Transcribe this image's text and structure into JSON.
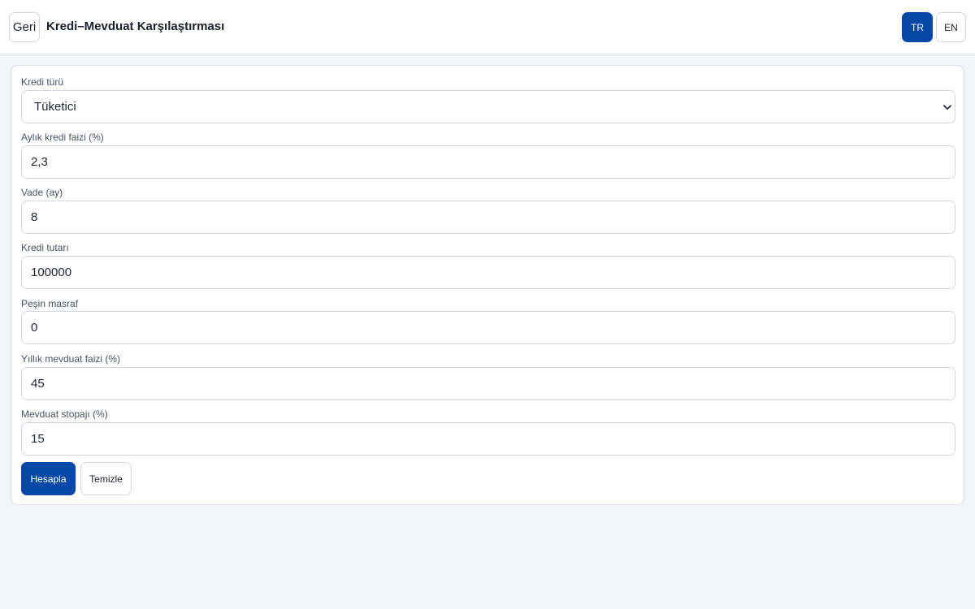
{
  "header": {
    "back_label": "Geri",
    "title": "Kredi–Mevduat Karşılaştırması",
    "lang_tr": "TR",
    "lang_en": "EN",
    "active_lang": "TR"
  },
  "form": {
    "loan_type": {
      "label": "Kredi türü",
      "value": "Tüketici"
    },
    "monthly_rate": {
      "label": "Aylık kredi faizi (%)",
      "value": "2,3"
    },
    "term": {
      "label": "Vade (ay)",
      "value": "8"
    },
    "amount": {
      "label": "Kredi tutarı",
      "value": "100000"
    },
    "upfront_fee": {
      "label": "Peşin masraf",
      "value": "0"
    },
    "deposit_rate": {
      "label": "Yıllık mevduat faizi (%)",
      "value": "45"
    },
    "withholding": {
      "label": "Mevduat stopajı (%)",
      "value": "15"
    }
  },
  "actions": {
    "calculate_label": "Hesapla",
    "clear_label": "Temizle"
  },
  "colors": {
    "primary": "#0747a6",
    "background": "#f3f5f9",
    "border": "#d4d9e1"
  },
  "icons": {
    "select_chevron": "chevron-down-icon"
  }
}
